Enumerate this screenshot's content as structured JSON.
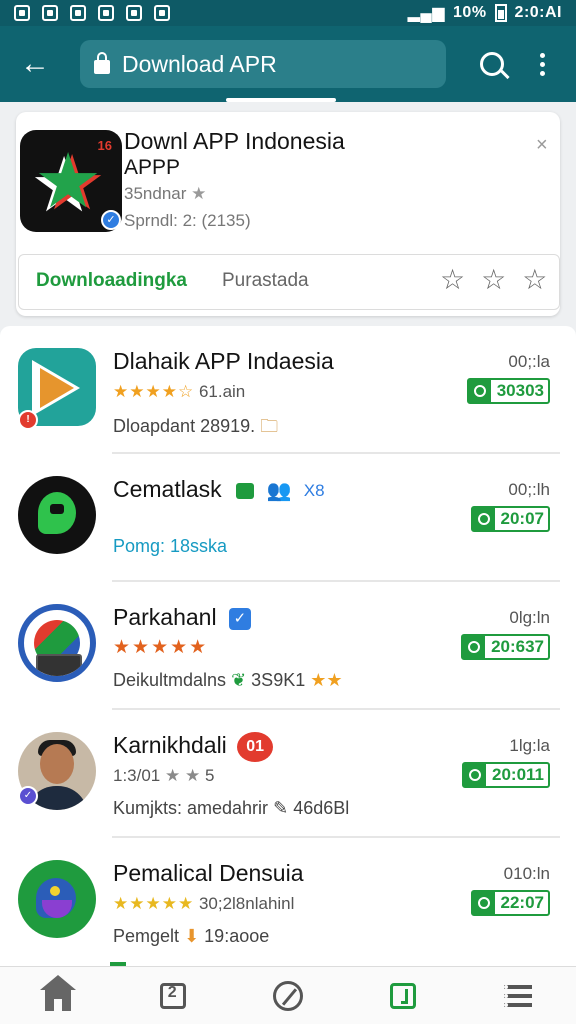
{
  "status_bar": {
    "battery": "10%",
    "time": "2:0:AI"
  },
  "app_bar": {
    "search_value": "Download APR"
  },
  "featured": {
    "title_line1": "Downl APP Indonesia",
    "title_line2": "APPP",
    "meta": "35ndnar",
    "sub": "Sprndl: 2: (2135)",
    "status_left": "Downloaadingka",
    "status_right": "Purastada",
    "close": "×"
  },
  "apps": [
    {
      "title": "Dlahaik APP Indaesia",
      "rating_stars": "★★★★☆",
      "rating_text": "61.ain",
      "line3": "Dloapdant 28919.",
      "time": "00;:la",
      "badge": "30303"
    },
    {
      "title": "Cematlask",
      "title_extra": "X8",
      "line3": "Pomg: 18sska",
      "time": "00;:lh",
      "badge": "20:07"
    },
    {
      "title": "Parkahanl",
      "rating_stars": "★★★★★",
      "line3": "Deikultmdalns",
      "line3_extra": "3S9K1",
      "time": "0lg:ln",
      "badge": "20:637"
    },
    {
      "title": "Karnikhdali",
      "title_extra": "01",
      "line2": "1:3/01",
      "line2_extra": "5",
      "line3": "Kumjkts: amedahrir",
      "line3_extra": "46d6Bl",
      "time": "1lg:la",
      "badge": "20:011"
    },
    {
      "title": "Pemalical Densuia",
      "rating_stars": "★★★★★",
      "rating_text": "30;2l8nlahinl",
      "line3": "Pemgelt",
      "line3_extra": "19:aooe",
      "time": "010:ln",
      "badge": "22:07"
    }
  ],
  "colors": {
    "primary": "#0f6470",
    "accent_green": "#1f9b3e",
    "star_orange": "#f0a020"
  }
}
